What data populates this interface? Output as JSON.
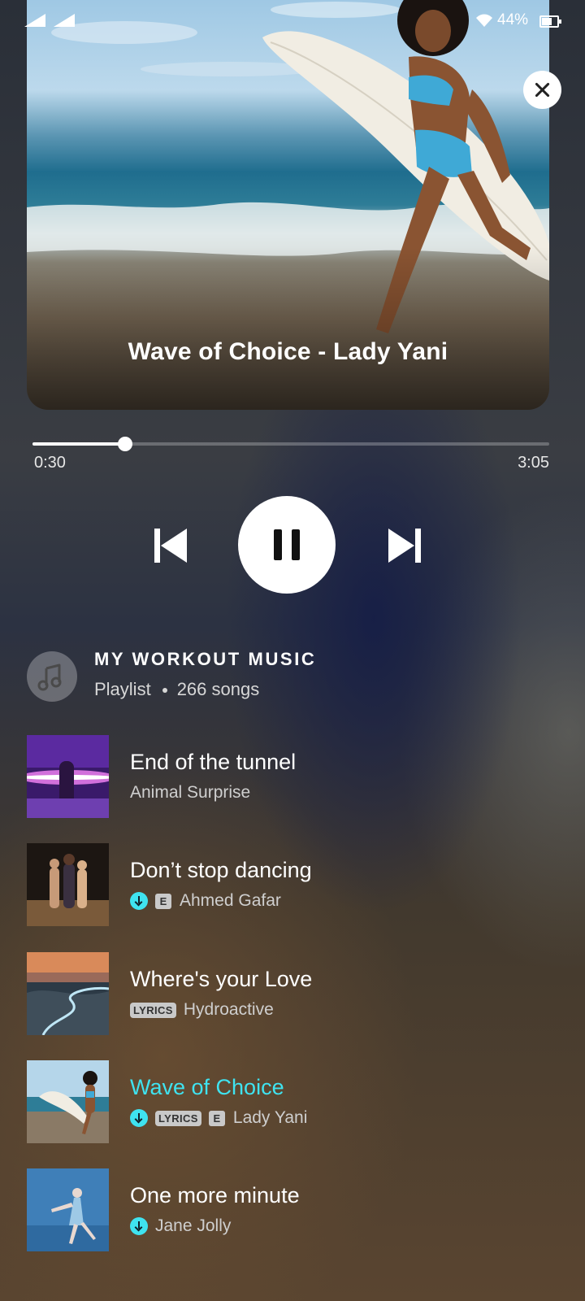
{
  "status_bar": {
    "battery": "44%"
  },
  "now_playing": {
    "title": "Wave of Choice - Lady Yani",
    "elapsed": "0:30",
    "total": "3:05",
    "progress": 0.179
  },
  "playlist": {
    "name": "MY WORKOUT MUSIC",
    "type": "Playlist",
    "count": "266 songs"
  },
  "colors": {
    "accent": "#3fe3f0"
  },
  "icons": [
    "signal-icon",
    "wifi-icon",
    "battery-icon",
    "close-icon",
    "previous-icon",
    "pause-icon",
    "next-icon",
    "music-note-icon",
    "download-icon",
    "explicit-badge",
    "lyrics-badge"
  ],
  "songs": [
    {
      "title": "End of the tunnel",
      "artist": "Animal Surprise",
      "downloaded": false,
      "lyrics": false,
      "explicit": false,
      "active": false
    },
    {
      "title": "Don’t stop dancing",
      "artist": "Ahmed Gafar",
      "downloaded": true,
      "lyrics": false,
      "explicit": true,
      "active": false
    },
    {
      "title": "Where's your Love",
      "artist": "Hydroactive",
      "downloaded": false,
      "lyrics": true,
      "explicit": false,
      "active": false
    },
    {
      "title": "Wave of Choice",
      "artist": "Lady Yani",
      "downloaded": true,
      "lyrics": true,
      "explicit": true,
      "active": true
    },
    {
      "title": "One more minute",
      "artist": "Jane Jolly",
      "downloaded": true,
      "lyrics": false,
      "explicit": false,
      "active": false
    }
  ],
  "badges": {
    "lyrics": "LYRICS",
    "explicit": "E"
  }
}
